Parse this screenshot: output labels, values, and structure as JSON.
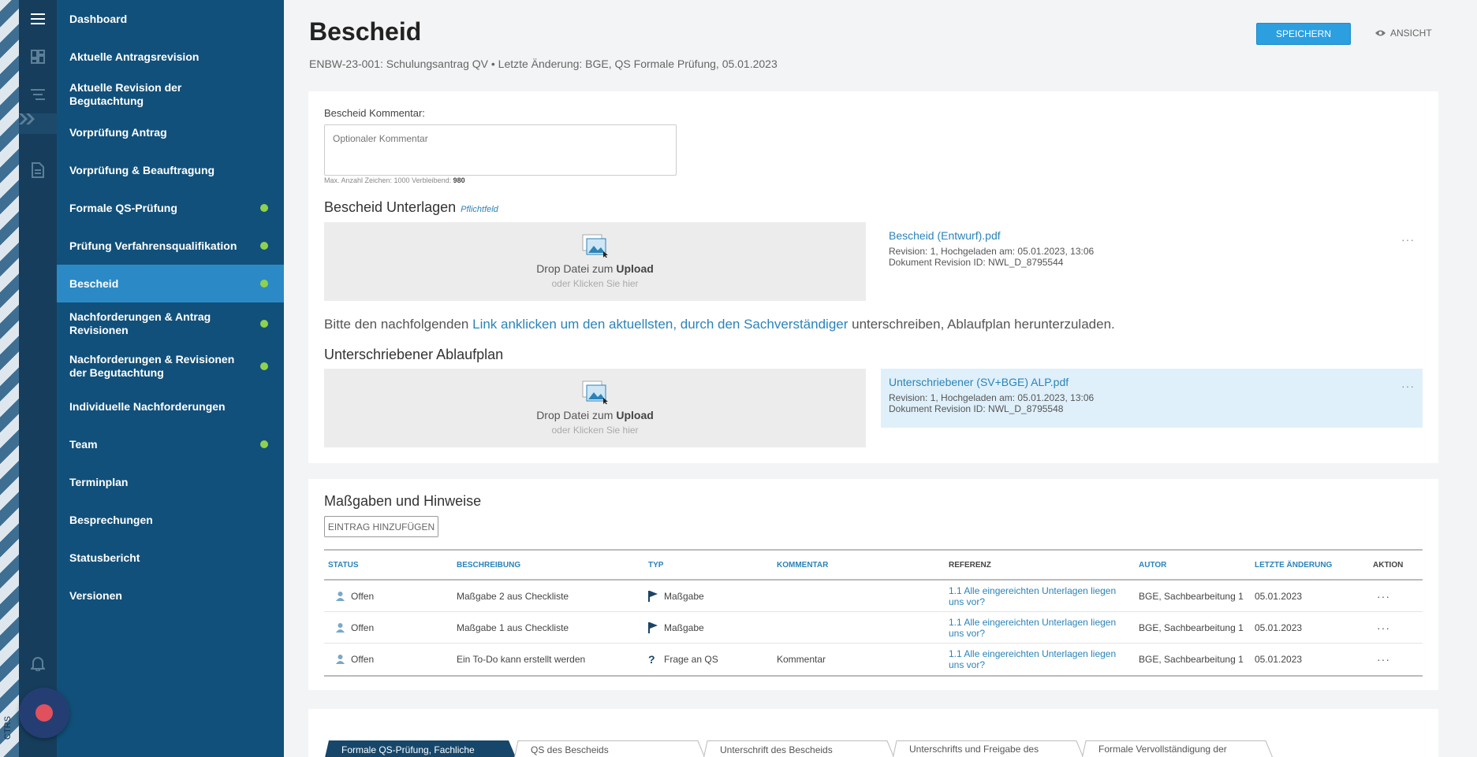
{
  "app": {
    "side_text": "CTRS"
  },
  "nav": {
    "items": [
      {
        "label": "Dashboard",
        "status": false
      },
      {
        "label": "Aktuelle Antragsrevision",
        "status": false
      },
      {
        "label": "Aktuelle Revision der Begutachtung",
        "status": false
      },
      {
        "label": "Vorprüfung Antrag",
        "status": false
      },
      {
        "label": "Vorprüfung & Beauftragung",
        "status": false
      },
      {
        "label": "Formale QS-Prüfung",
        "status": true
      },
      {
        "label": "Prüfung Verfahrensqualifikation",
        "status": true
      },
      {
        "label": "Bescheid",
        "status": true,
        "active": true
      },
      {
        "label": "Nachforderungen & Antrag Revisionen",
        "status": true
      },
      {
        "label": "Nachforderungen & Revisionen der Begutachtung",
        "status": true
      },
      {
        "label": "Individuelle Nachforderungen",
        "status": false
      },
      {
        "label": "Team",
        "status": true
      },
      {
        "label": "Terminplan",
        "status": false
      },
      {
        "label": "Besprechungen",
        "status": false
      },
      {
        "label": "Statusbericht",
        "status": false
      },
      {
        "label": "Versionen",
        "status": false
      }
    ]
  },
  "header": {
    "title": "Bescheid",
    "subtitle": "ENBW-23-001: Schulungsantrag QV  •  Letzte Änderung: BGE, QS Formale Prüfung, 05.01.2023",
    "save_label": "SPEICHERN",
    "view_label": "ANSICHT"
  },
  "comment": {
    "label": "Bescheid Kommentar:",
    "placeholder": "Optionaler Kommentar",
    "limit_text": "Max. Anzahl Zeichen: 1000 Verbleibend:",
    "remaining": "980"
  },
  "documents": {
    "title": "Bescheid Unterlagen",
    "required": "Pflichtfeld",
    "drop_text": "Drop Datei zum",
    "drop_bold": "Upload",
    "drop_sub": "oder Klicken Sie hier",
    "file": {
      "name": "Bescheid (Entwurf).pdf",
      "revision": "Revision: 1, Hochgeladen am: 05.01.2023, 13:06",
      "doc_id": "Dokument Revision ID: NWL_D_8795544"
    }
  },
  "note": {
    "before": "Bitte den nachfolgenden ",
    "link": "Link anklicken um den aktuellsten, durch den Sachverständiger",
    "after": " unterschreiben, Ablaufplan herunterzuladen."
  },
  "signed": {
    "title": "Unterschriebener Ablaufplan",
    "drop_text": "Drop Datei zum",
    "drop_bold": "Upload",
    "drop_sub": "oder Klicken Sie hier",
    "file": {
      "name": "Unterschriebener (SV+BGE) ALP.pdf",
      "revision": "Revision: 1, Hochgeladen am: 05.01.2023, 13:06",
      "doc_id": "Dokument Revision ID: NWL_D_8795548"
    }
  },
  "massgaben": {
    "title": "Maßgaben und Hinweise",
    "add_label": "EINTRAG HINZUFÜGEN",
    "columns": [
      "STATUS",
      "BESCHREIBUNG",
      "TYP",
      "KOMMENTAR",
      "REFERENZ",
      "AUTOR",
      "LETZTE ÄNDERUNG",
      "AKTION"
    ],
    "rows": [
      {
        "status": "Offen",
        "beschreibung": "Maßgabe 2 aus Checkliste",
        "typ": "Maßgabe",
        "typ_icon": "flag-icon",
        "kommentar": "",
        "referenz": "1.1 Alle eingereichten Unterlagen liegen uns vor?",
        "autor": "BGE, Sachbearbeitung 1",
        "datum": "05.01.2023"
      },
      {
        "status": "Offen",
        "beschreibung": "Maßgabe 1 aus Checkliste",
        "typ": "Maßgabe",
        "typ_icon": "flag-icon",
        "kommentar": "",
        "referenz": "1.1 Alle eingereichten Unterlagen liegen uns vor?",
        "autor": "BGE, Sachbearbeitung 1",
        "datum": "05.01.2023"
      },
      {
        "status": "Offen",
        "beschreibung": "Ein To-Do kann erstellt werden",
        "typ": "Frage an QS",
        "typ_icon": "question-icon",
        "kommentar": "Kommentar",
        "referenz": "1.1 Alle eingereichten Unterlagen liegen uns vor?",
        "autor": "BGE, Sachbearbeitung 1",
        "datum": "05.01.2023"
      }
    ]
  },
  "steps": [
    {
      "label": "Formale QS-Prüfung, Fachliche",
      "active": true
    },
    {
      "label": "QS des Bescheids",
      "active": false
    },
    {
      "label": "Unterschrift des Bescheids",
      "active": false
    },
    {
      "label": "Unterschrifts und Freigabe des",
      "active": false
    },
    {
      "label": "Formale Vervollständigung der",
      "active": false
    }
  ],
  "colors": {
    "nav_bg": "#11507a",
    "nav_active": "#2b8ac6",
    "accent": "#2b9fe0",
    "link": "#2b83b9",
    "status_dot": "#8fd14f"
  }
}
